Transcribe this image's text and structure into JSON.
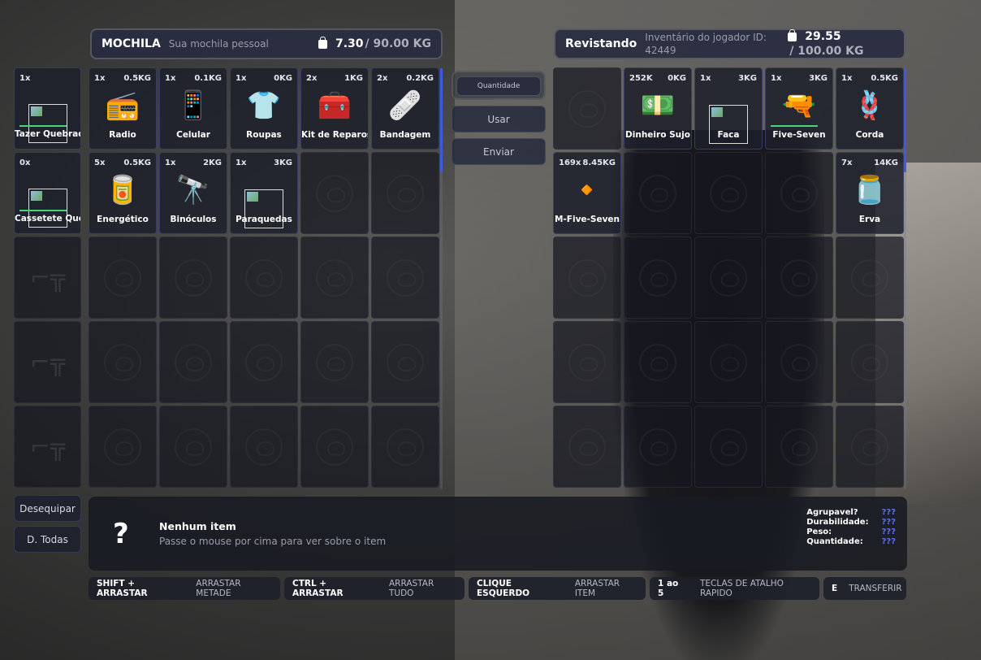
{
  "backpack": {
    "title": "MOCHILA",
    "subtitle": "Sua mochila pessoal",
    "weight": "7.30",
    "max_weight": "/ 90.00 KG"
  },
  "search": {
    "title": "Revistando",
    "subtitle": "Inventário do jogador ID: 42449",
    "weight": "29.55",
    "max_weight": "/ 100.00 KG"
  },
  "equip_slots": [
    {
      "qty": "1x",
      "name": "Tazer Quebrado",
      "icon": "broken-image-icon",
      "durability": 1.0
    },
    {
      "qty": "0x",
      "name": "Cassetete Quebrado",
      "icon": "broken-image-icon",
      "durability": 1.0
    },
    {
      "qty": "",
      "name": "",
      "icon": "rifle-watermark-icon"
    },
    {
      "qty": "",
      "name": "",
      "icon": "rifle-watermark-icon"
    },
    {
      "qty": "",
      "name": "",
      "icon": "rifle-watermark-icon"
    }
  ],
  "backpack_items": [
    {
      "qty": "1x",
      "weight": "0.5KG",
      "name": "Radio",
      "icon": "📻"
    },
    {
      "qty": "1x",
      "weight": "0.1KG",
      "name": "Celular",
      "icon": "📱"
    },
    {
      "qty": "1x",
      "weight": "0KG",
      "name": "Roupas",
      "icon": "👕"
    },
    {
      "qty": "2x",
      "weight": "1KG",
      "name": "Kit de Reparos",
      "icon": "🧰"
    },
    {
      "qty": "2x",
      "weight": "0.2KG",
      "name": "Bandagem",
      "icon": "🩹"
    },
    {
      "qty": "5x",
      "weight": "0.5KG",
      "name": "Energético",
      "icon": "🥫"
    },
    {
      "qty": "1x",
      "weight": "2KG",
      "name": "Binóculos",
      "icon": "🔭"
    },
    {
      "qty": "1x",
      "weight": "3KG",
      "name": "Paraquedas",
      "icon": "broken"
    }
  ],
  "search_items": [
    {
      "qty": "",
      "weight": "",
      "name": "",
      "icon": ""
    },
    {
      "qty": "252K",
      "weight": "0KG",
      "name": "Dinheiro Sujo",
      "icon": "💵"
    },
    {
      "qty": "1x",
      "weight": "3KG",
      "name": "Faca",
      "icon": "broken"
    },
    {
      "qty": "1x",
      "weight": "3KG",
      "name": "Five-Seven",
      "icon": "🔫",
      "durability": 1.0
    },
    {
      "qty": "1x",
      "weight": "0.5KG",
      "name": "Corda",
      "icon": "🪢"
    },
    {
      "qty": "169x",
      "weight": "8.45KG",
      "name": "M-Five-Seven",
      "icon": "🔸"
    },
    {
      "qty": "",
      "weight": "",
      "name": "",
      "icon": ""
    },
    {
      "qty": "",
      "weight": "",
      "name": "",
      "icon": ""
    },
    {
      "qty": "",
      "weight": "",
      "name": "",
      "icon": ""
    },
    {
      "qty": "7x",
      "weight": "14KG",
      "name": "Erva",
      "icon": "🫙"
    }
  ],
  "actions": {
    "quantity_placeholder": "Quantidade",
    "use": "Usar",
    "send": "Enviar"
  },
  "side_buttons": {
    "unequip": "Desequipar",
    "unequip_all": "D. Todas"
  },
  "info": {
    "symbol": "?",
    "title": "Nenhum item",
    "description": "Passe o mouse por cima para ver sobre o item",
    "props": [
      {
        "label": "Agrupavel?",
        "value": "???"
      },
      {
        "label": "Durabilidade:",
        "value": "???"
      },
      {
        "label": "Peso:",
        "value": "???"
      },
      {
        "label": "Quantidade:",
        "value": "???"
      }
    ]
  },
  "hotkeys": [
    {
      "key": "SHIFT + ARRASTAR",
      "action": "ARRASTAR METADE"
    },
    {
      "key": "CTRL + ARRASTAR",
      "action": "ARRASTAR TUDO"
    },
    {
      "key": "CLIQUE ESQUERDO",
      "action": "ARRASTAR ITEM"
    },
    {
      "key": "1 ao 5",
      "action": "TECLAS DE ATALHO RAPIDO"
    },
    {
      "key": "E",
      "action": "TRANSFERIR"
    }
  ],
  "colors": {
    "accent": "#3f5bdc",
    "durability": "#4ed07c",
    "prop_value": "#5b6ef0"
  }
}
